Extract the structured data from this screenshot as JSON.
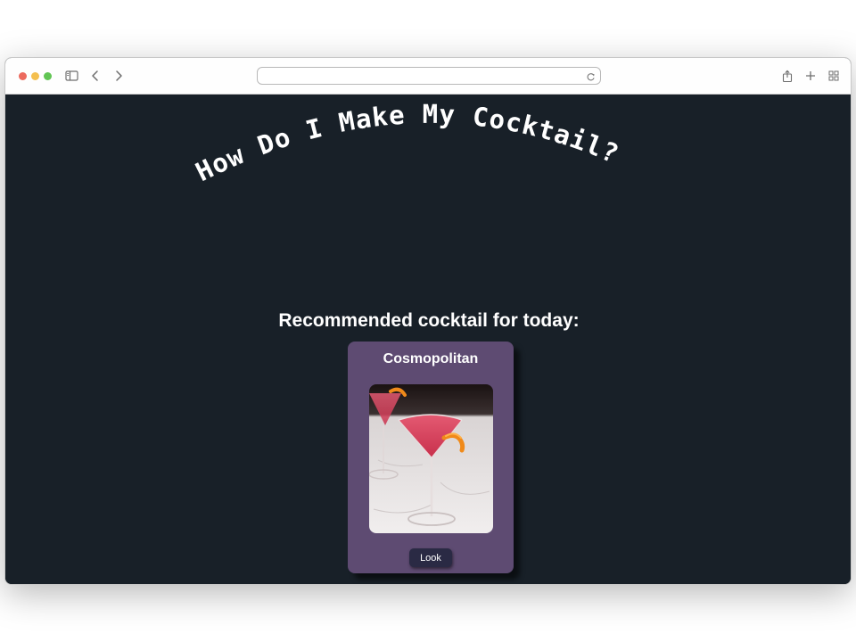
{
  "browser": {
    "address_value": "",
    "icons": [
      "sidebar-icon",
      "back-icon",
      "forward-icon",
      "reload-icon",
      "share-icon",
      "new-tab-icon",
      "tab-overview-icon"
    ]
  },
  "page": {
    "title_words": [
      "How",
      "Do",
      "I",
      "Make",
      "My",
      "Cocktail?"
    ],
    "recommended_heading": "Recommended cocktail for today:",
    "card": {
      "name": "Cosmopolitan",
      "button_label": "Look"
    }
  },
  "colors": {
    "page_background": "#182028",
    "card_background": "#5e4b72",
    "button_background": "#2a2a44",
    "text": "#ffffff"
  }
}
